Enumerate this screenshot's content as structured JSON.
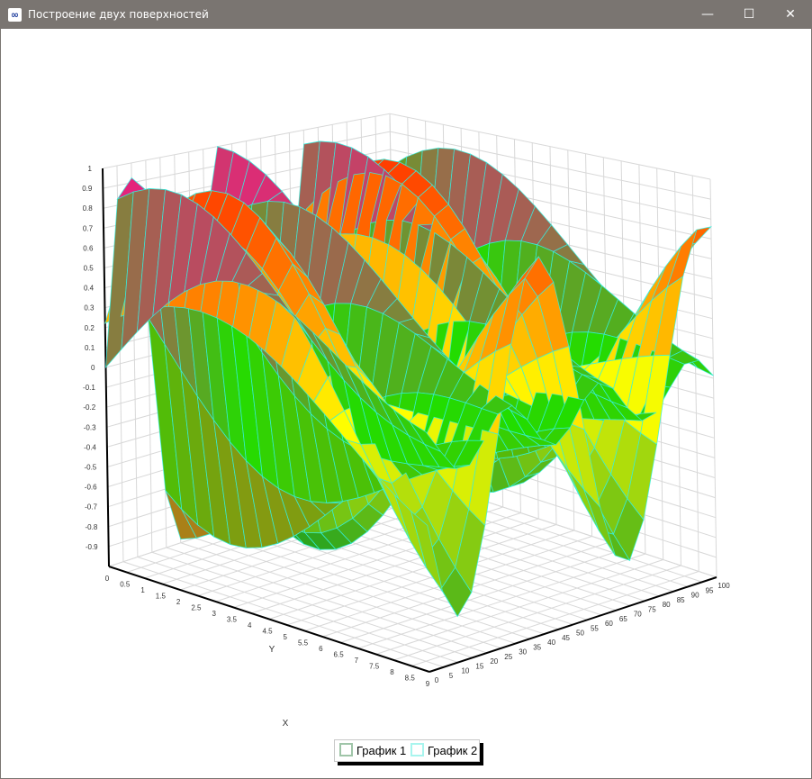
{
  "window": {
    "title": "Построение двух поверхностей",
    "minimize": "—",
    "maximize": "☐",
    "close": "✕"
  },
  "chart_data": {
    "type": "surface3d",
    "title": "",
    "xlabel": "X",
    "ylabel": "Y",
    "zlabel": "",
    "xlim": [
      0,
      100
    ],
    "ylim": [
      0,
      9
    ],
    "zlim": [
      -1,
      1
    ],
    "x_ticks": [
      "0",
      "5",
      "10",
      "15",
      "20",
      "25",
      "30",
      "35",
      "40",
      "45",
      "50",
      "55",
      "60",
      "65",
      "70",
      "75",
      "80",
      "85",
      "90",
      "95",
      "100"
    ],
    "y_ticks": [
      "0",
      "0.5",
      "1",
      "1.5",
      "2",
      "2.5",
      "3",
      "3.5",
      "4",
      "4.5",
      "5",
      "5.5",
      "6",
      "6.5",
      "7",
      "7.5",
      "8",
      "8.5",
      "9"
    ],
    "z_ticks": [
      "-0.9",
      "-0.8",
      "-0.7",
      "-0.6",
      "-0.5",
      "-0.4",
      "-0.3",
      "-0.2",
      "-0.1",
      "0",
      "0.1",
      "0.2",
      "0.3",
      "0.4",
      "0.5",
      "0.6",
      "0.7",
      "0.8",
      "0.9",
      "1"
    ],
    "grid": true,
    "legend_position": "bottom-center",
    "series": [
      {
        "name": "График 1",
        "colormap": [
          "#c0701c",
          "#22dd00",
          "#ff0a8c"
        ],
        "mesh_color": "#35f0e0",
        "legend_color": "#9fc5a8"
      },
      {
        "name": "График 2",
        "colormap": [
          "#129a22",
          "#ffff00",
          "#ff2a00"
        ],
        "mesh_color": "#35f0e0",
        "legend_color": "#a8f5ee"
      }
    ]
  }
}
